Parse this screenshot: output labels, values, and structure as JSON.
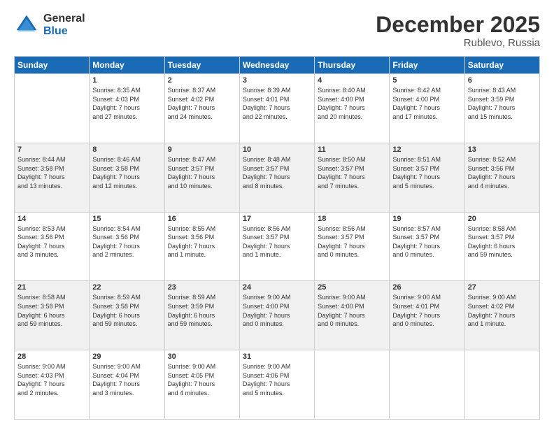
{
  "logo": {
    "general": "General",
    "blue": "Blue"
  },
  "title": "December 2025",
  "location": "Rublevo, Russia",
  "days_of_week": [
    "Sunday",
    "Monday",
    "Tuesday",
    "Wednesday",
    "Thursday",
    "Friday",
    "Saturday"
  ],
  "weeks": [
    [
      {
        "day": "",
        "info": ""
      },
      {
        "day": "1",
        "info": "Sunrise: 8:35 AM\nSunset: 4:03 PM\nDaylight: 7 hours\nand 27 minutes."
      },
      {
        "day": "2",
        "info": "Sunrise: 8:37 AM\nSunset: 4:02 PM\nDaylight: 7 hours\nand 24 minutes."
      },
      {
        "day": "3",
        "info": "Sunrise: 8:39 AM\nSunset: 4:01 PM\nDaylight: 7 hours\nand 22 minutes."
      },
      {
        "day": "4",
        "info": "Sunrise: 8:40 AM\nSunset: 4:00 PM\nDaylight: 7 hours\nand 20 minutes."
      },
      {
        "day": "5",
        "info": "Sunrise: 8:42 AM\nSunset: 4:00 PM\nDaylight: 7 hours\nand 17 minutes."
      },
      {
        "day": "6",
        "info": "Sunrise: 8:43 AM\nSunset: 3:59 PM\nDaylight: 7 hours\nand 15 minutes."
      }
    ],
    [
      {
        "day": "7",
        "info": "Sunrise: 8:44 AM\nSunset: 3:58 PM\nDaylight: 7 hours\nand 13 minutes."
      },
      {
        "day": "8",
        "info": "Sunrise: 8:46 AM\nSunset: 3:58 PM\nDaylight: 7 hours\nand 12 minutes."
      },
      {
        "day": "9",
        "info": "Sunrise: 8:47 AM\nSunset: 3:57 PM\nDaylight: 7 hours\nand 10 minutes."
      },
      {
        "day": "10",
        "info": "Sunrise: 8:48 AM\nSunset: 3:57 PM\nDaylight: 7 hours\nand 8 minutes."
      },
      {
        "day": "11",
        "info": "Sunrise: 8:50 AM\nSunset: 3:57 PM\nDaylight: 7 hours\nand 7 minutes."
      },
      {
        "day": "12",
        "info": "Sunrise: 8:51 AM\nSunset: 3:57 PM\nDaylight: 7 hours\nand 5 minutes."
      },
      {
        "day": "13",
        "info": "Sunrise: 8:52 AM\nSunset: 3:56 PM\nDaylight: 7 hours\nand 4 minutes."
      }
    ],
    [
      {
        "day": "14",
        "info": "Sunrise: 8:53 AM\nSunset: 3:56 PM\nDaylight: 7 hours\nand 3 minutes."
      },
      {
        "day": "15",
        "info": "Sunrise: 8:54 AM\nSunset: 3:56 PM\nDaylight: 7 hours\nand 2 minutes."
      },
      {
        "day": "16",
        "info": "Sunrise: 8:55 AM\nSunset: 3:56 PM\nDaylight: 7 hours\nand 1 minute."
      },
      {
        "day": "17",
        "info": "Sunrise: 8:56 AM\nSunset: 3:57 PM\nDaylight: 7 hours\nand 1 minute."
      },
      {
        "day": "18",
        "info": "Sunrise: 8:56 AM\nSunset: 3:57 PM\nDaylight: 7 hours\nand 0 minutes."
      },
      {
        "day": "19",
        "info": "Sunrise: 8:57 AM\nSunset: 3:57 PM\nDaylight: 7 hours\nand 0 minutes."
      },
      {
        "day": "20",
        "info": "Sunrise: 8:58 AM\nSunset: 3:57 PM\nDaylight: 6 hours\nand 59 minutes."
      }
    ],
    [
      {
        "day": "21",
        "info": "Sunrise: 8:58 AM\nSunset: 3:58 PM\nDaylight: 6 hours\nand 59 minutes."
      },
      {
        "day": "22",
        "info": "Sunrise: 8:59 AM\nSunset: 3:58 PM\nDaylight: 6 hours\nand 59 minutes."
      },
      {
        "day": "23",
        "info": "Sunrise: 8:59 AM\nSunset: 3:59 PM\nDaylight: 6 hours\nand 59 minutes."
      },
      {
        "day": "24",
        "info": "Sunrise: 9:00 AM\nSunset: 4:00 PM\nDaylight: 7 hours\nand 0 minutes."
      },
      {
        "day": "25",
        "info": "Sunrise: 9:00 AM\nSunset: 4:00 PM\nDaylight: 7 hours\nand 0 minutes."
      },
      {
        "day": "26",
        "info": "Sunrise: 9:00 AM\nSunset: 4:01 PM\nDaylight: 7 hours\nand 0 minutes."
      },
      {
        "day": "27",
        "info": "Sunrise: 9:00 AM\nSunset: 4:02 PM\nDaylight: 7 hours\nand 1 minute."
      }
    ],
    [
      {
        "day": "28",
        "info": "Sunrise: 9:00 AM\nSunset: 4:03 PM\nDaylight: 7 hours\nand 2 minutes."
      },
      {
        "day": "29",
        "info": "Sunrise: 9:00 AM\nSunset: 4:04 PM\nDaylight: 7 hours\nand 3 minutes."
      },
      {
        "day": "30",
        "info": "Sunrise: 9:00 AM\nSunset: 4:05 PM\nDaylight: 7 hours\nand 4 minutes."
      },
      {
        "day": "31",
        "info": "Sunrise: 9:00 AM\nSunset: 4:06 PM\nDaylight: 7 hours\nand 5 minutes."
      },
      {
        "day": "",
        "info": ""
      },
      {
        "day": "",
        "info": ""
      },
      {
        "day": "",
        "info": ""
      }
    ]
  ]
}
